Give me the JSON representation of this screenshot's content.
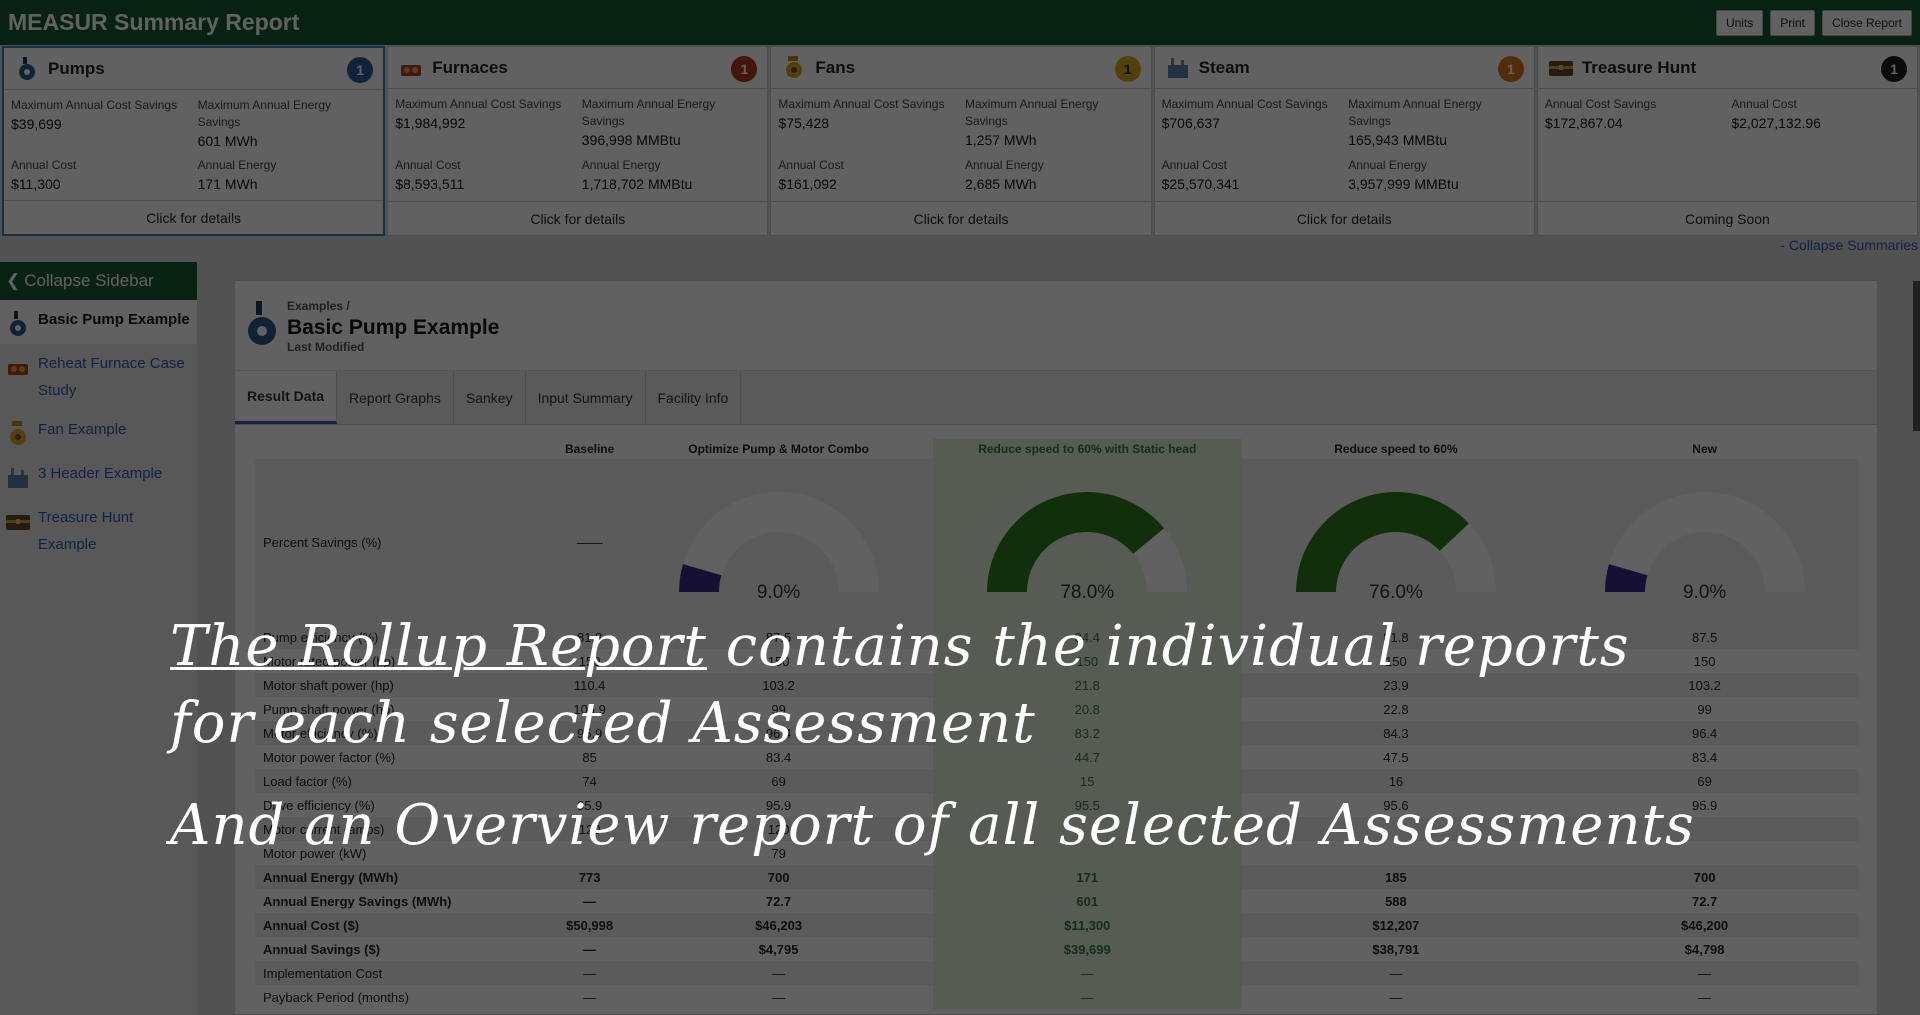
{
  "app": {
    "title": "MEASUR Summary Report"
  },
  "top_buttons": {
    "units": "Units",
    "print": "Print",
    "close": "Close Report"
  },
  "summary_cards": [
    {
      "title": "Pumps",
      "badge": "1",
      "badge_color": "#2c5d9a",
      "m1_label": "Maximum Annual Cost Savings",
      "m1_value": "$39,699",
      "m2_label": "Maximum Annual Energy Savings",
      "m2_value": "601 MWh",
      "m3_label": "Annual Cost",
      "m3_value": "$11,300",
      "m4_label": "Annual Energy",
      "m4_value": "171 MWh",
      "footer": "Click for details",
      "icon": "pump-icon"
    },
    {
      "title": "Furnaces",
      "badge": "1",
      "badge_color": "#b23a1e",
      "m1_label": "Maximum Annual Cost Savings",
      "m1_value": "$1,984,992",
      "m2_label": "Maximum Annual Energy Savings",
      "m2_value": "396,998 MMBtu",
      "m3_label": "Annual Cost",
      "m3_value": "$8,593,511",
      "m4_label": "Annual Energy",
      "m4_value": "1,718,702 MMBtu",
      "footer": "Click for details",
      "icon": "furnace-icon"
    },
    {
      "title": "Fans",
      "badge": "1",
      "badge_color": "#d9a91a",
      "m1_label": "Maximum Annual Cost Savings",
      "m1_value": "$75,428",
      "m2_label": "Maximum Annual Energy Savings",
      "m2_value": "1,257 MWh",
      "m3_label": "Annual Cost",
      "m3_value": "$161,092",
      "m4_label": "Annual Energy",
      "m4_value": "2,685 MWh",
      "footer": "Click for details",
      "icon": "fan-icon"
    },
    {
      "title": "Steam",
      "badge": "1",
      "badge_color": "#d9761a",
      "m1_label": "Maximum Annual Cost Savings",
      "m1_value": "$706,637",
      "m2_label": "Maximum Annual Energy Savings",
      "m2_value": "165,943 MMBtu",
      "m3_label": "Annual Cost",
      "m3_value": "$25,570,341",
      "m4_label": "Annual Energy",
      "m4_value": "3,957,999 MMBtu",
      "footer": "Click for details",
      "icon": "steam-icon"
    },
    {
      "title": "Treasure Hunt",
      "badge": "1",
      "badge_color": "#1b1b1b",
      "m1_label": "Annual Cost Savings",
      "m1_value": "$172,867.04",
      "m2_label": "Annual Cost",
      "m2_value": "$2,027,132.96",
      "m3_label": "",
      "m3_value": "",
      "m4_label": "",
      "m4_value": "",
      "footer": "Coming Soon",
      "icon": "treasure-chest-icon"
    }
  ],
  "collapse_summaries": "- Collapse Summaries",
  "sidebar": {
    "collapse_label": "Collapse Sidebar",
    "items": [
      {
        "label": "Basic Pump Example",
        "icon": "pump-icon"
      },
      {
        "label": "Reheat Furnace Case Study",
        "icon": "furnace-icon"
      },
      {
        "label": "Fan Example",
        "icon": "fan-icon"
      },
      {
        "label": "3 Header Example",
        "icon": "steam-icon"
      },
      {
        "label": "Treasure Hunt Example",
        "icon": "treasure-chest-icon"
      }
    ]
  },
  "assessment": {
    "breadcrumb": "Examples /",
    "title": "Basic Pump Example",
    "last_modified": "Last Modified"
  },
  "tabs": [
    "Result Data",
    "Report Graphs",
    "Sankey",
    "Input Summary",
    "Facility Info"
  ],
  "table": {
    "columns": [
      "Baseline",
      "Optimize Pump & Motor Combo",
      "Reduce speed to 60% with Static head",
      "Reduce speed to 60%",
      "New"
    ],
    "percent_label": "Percent Savings (%)",
    "baseline_percent": "——",
    "gauges": [
      {
        "value": 9.0,
        "text": "9.0%",
        "color": "#3b2a8a"
      },
      {
        "value": 78.0,
        "text": "78.0%",
        "color": "#2e7d1e"
      },
      {
        "value": 76.0,
        "text": "76.0%",
        "color": "#2e7d1e"
      },
      {
        "value": 9.0,
        "text": "9.0%",
        "color": "#3b2a8a"
      }
    ],
    "rows": [
      {
        "label": "Pump efficiency (%)",
        "values": [
          "81.8",
          "87.5",
          "84.4",
          "81.8",
          "87.5"
        ]
      },
      {
        "label": "Motor rated power (hp)",
        "values": [
          "150",
          "150",
          "150",
          "150",
          "150"
        ]
      },
      {
        "label": "Motor shaft power (hp)",
        "values": [
          "110.4",
          "103.2",
          "21.8",
          "23.9",
          "103.2"
        ]
      },
      {
        "label": "Pump shaft power (hp)",
        "values": [
          "105.9",
          "99",
          "20.8",
          "22.8",
          "99"
        ]
      },
      {
        "label": "Motor efficiency (%)",
        "values": [
          "95.9",
          "96.4",
          "83.2",
          "84.3",
          "96.4"
        ]
      },
      {
        "label": "Motor power factor (%)",
        "values": [
          "85",
          "83.4",
          "44.7",
          "47.5",
          "83.4"
        ]
      },
      {
        "label": "Load factor (%)",
        "values": [
          "74",
          "69",
          "15",
          "16",
          "69"
        ]
      },
      {
        "label": "Drive efficiency (%)",
        "values": [
          "95.9",
          "95.9",
          "95.5",
          "95.6",
          "95.9"
        ]
      },
      {
        "label": "Motor current (amps)",
        "values": [
          "120",
          "120",
          "",
          "",
          ""
        ]
      },
      {
        "label": "Motor power (kW)",
        "values": [
          "",
          "79",
          "",
          "",
          ""
        ]
      },
      {
        "label": "Annual Energy (MWh)",
        "values": [
          "773",
          "700",
          "171",
          "185",
          "700"
        ],
        "bold": true
      },
      {
        "label": "Annual Energy Savings (MWh)",
        "values": [
          "—",
          "72.7",
          "601",
          "588",
          "72.7"
        ],
        "bold": true
      },
      {
        "label": "Annual Cost ($)",
        "values": [
          "$50,998",
          "$46,203",
          "$11,300",
          "$12,207",
          "$46,200"
        ],
        "bold": true
      },
      {
        "label": "Annual Savings ($)",
        "values": [
          "—",
          "$4,795",
          "$39,699",
          "$38,791",
          "$4,798"
        ],
        "bold": true
      },
      {
        "label": "Implementation Cost",
        "values": [
          "—",
          "—",
          "—",
          "—",
          "—"
        ]
      },
      {
        "label": "Payback Period (months)",
        "values": [
          "—",
          "—",
          "—",
          "—",
          "—"
        ]
      }
    ]
  },
  "tutorial": {
    "line1_link": "The Rollup Report",
    "line1_rest": " contains the individual reports",
    "line2": "for each selected Assessment",
    "line3": "And an Overview report of all selected Assessments"
  }
}
